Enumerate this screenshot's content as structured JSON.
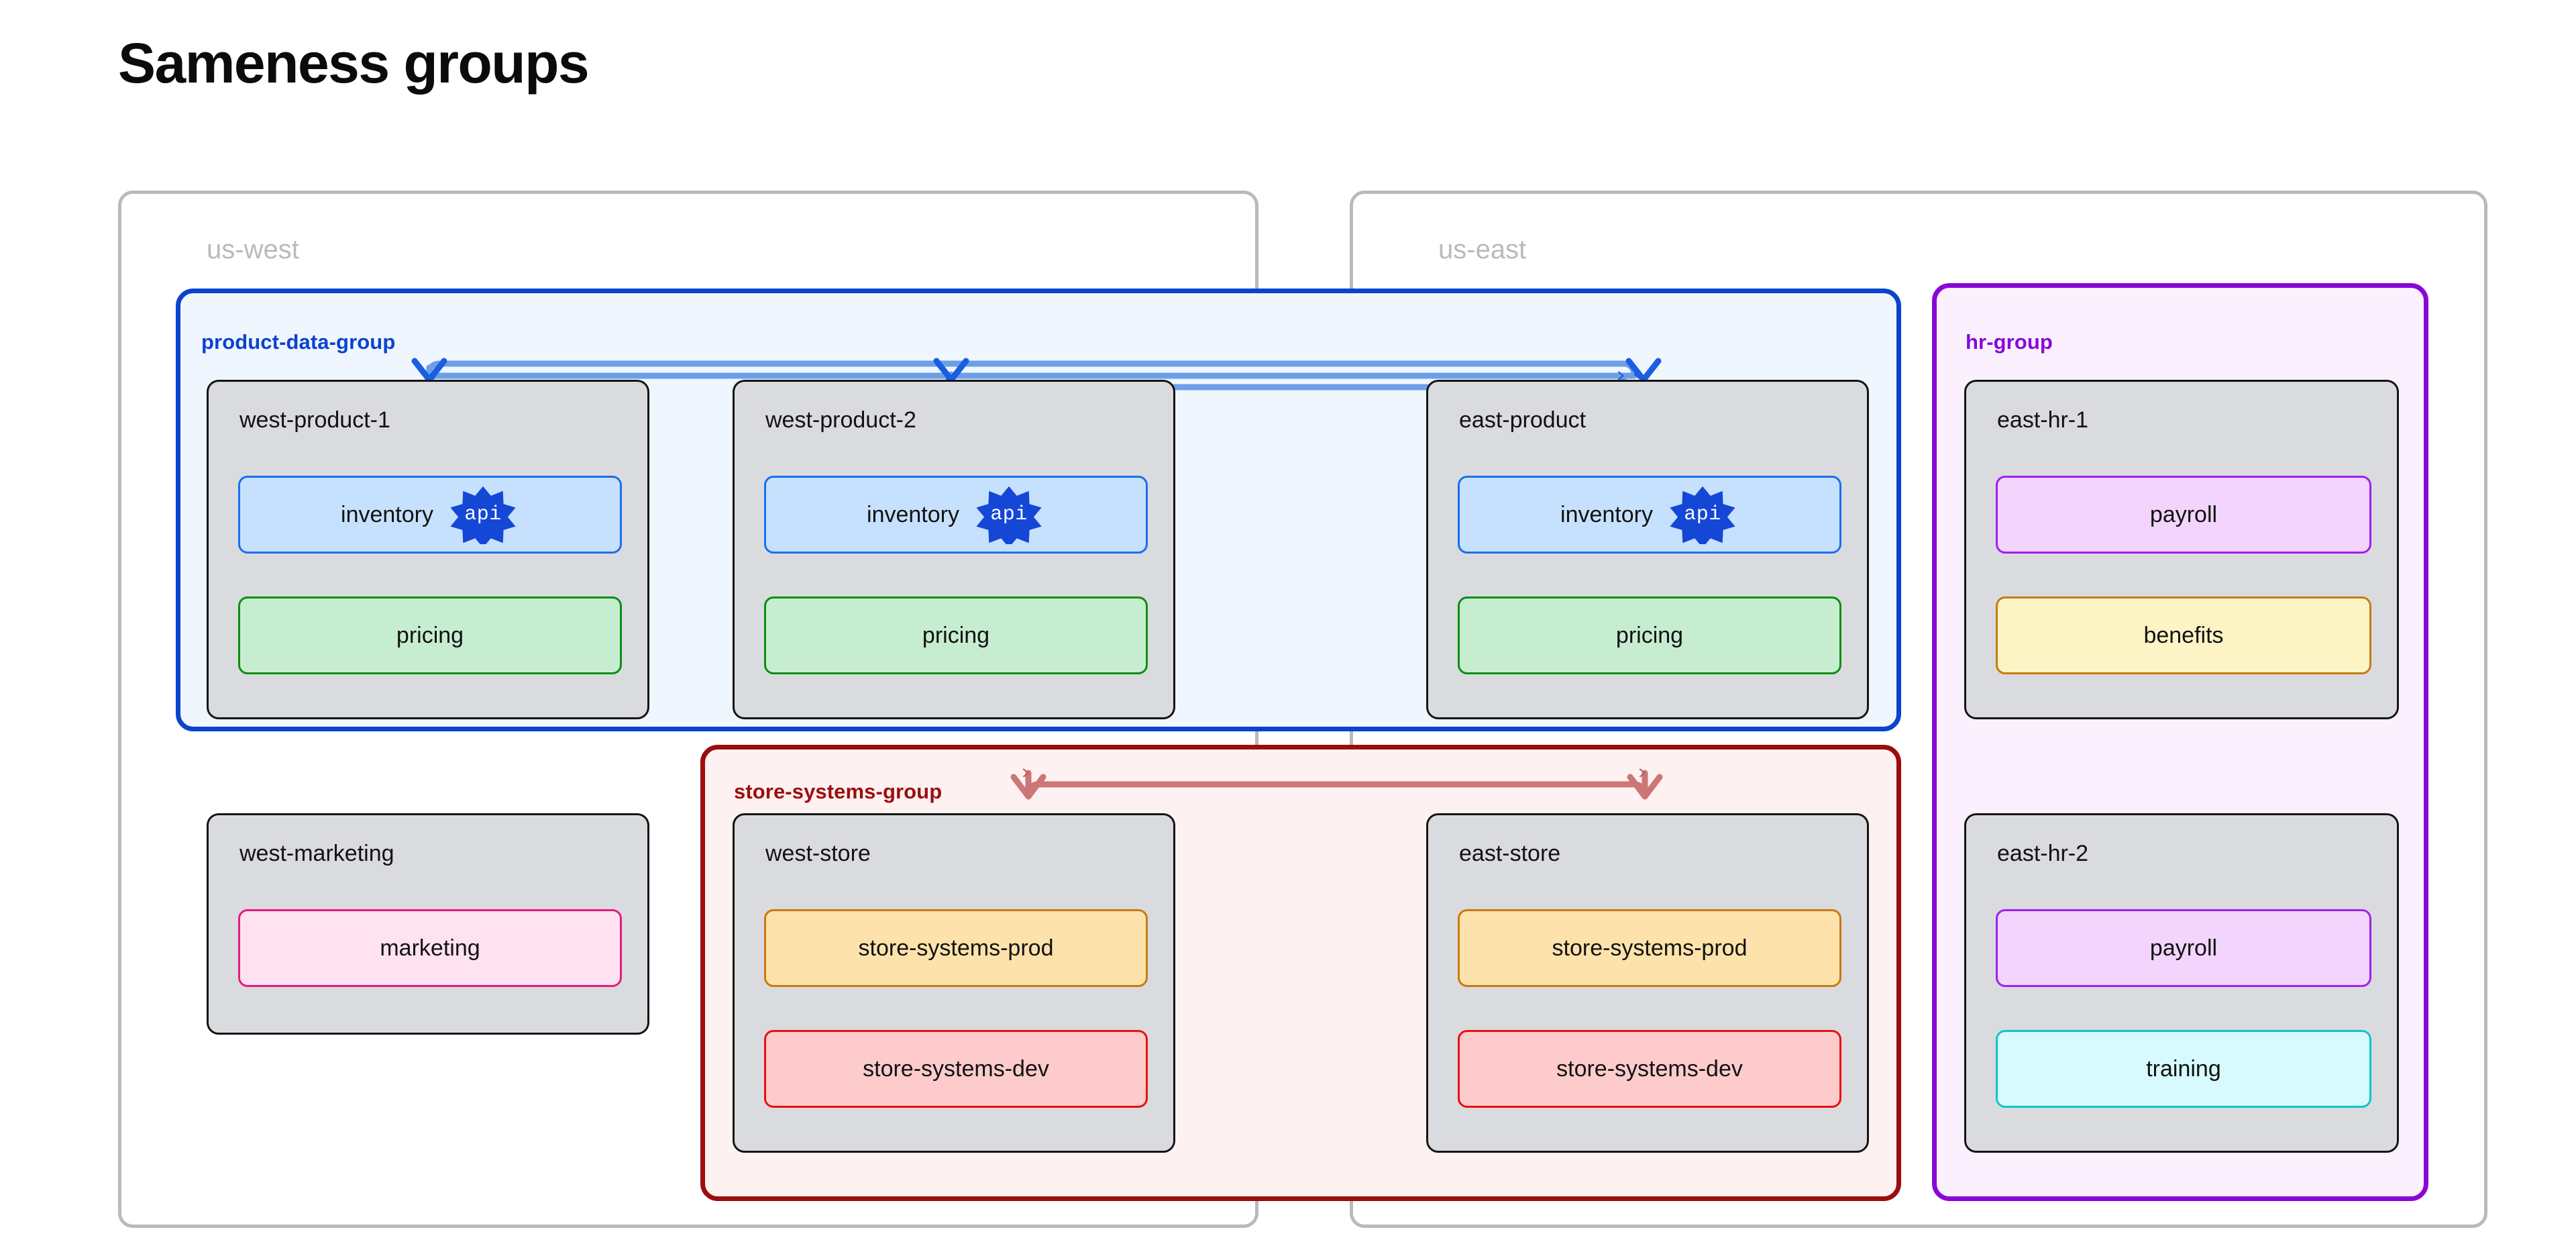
{
  "page": {
    "title": "Sameness groups"
  },
  "regions": [
    {
      "id": "us-west",
      "label": "us-west"
    },
    {
      "id": "us-east",
      "label": "us-east"
    }
  ],
  "groups": [
    {
      "id": "product-data-group",
      "label": "product-data-group",
      "border_color": "#0b43cf",
      "fill_color": "#f0f6fe"
    },
    {
      "id": "store-systems-group",
      "label": "store-systems-group",
      "border_color": "#9c0d0d",
      "fill_color": "#fdf2f1"
    },
    {
      "id": "hr-group",
      "label": "hr-group",
      "border_color": "#8a06d6",
      "fill_color": "#fbf1fe"
    }
  ],
  "nodes": [
    {
      "id": "west-product-1",
      "title": "west-product-1",
      "region": "us-west",
      "group": "product-data-group",
      "services": [
        {
          "id": "inventory",
          "label": "inventory",
          "badge": "api",
          "fill": "#c6e1fd",
          "border": "#1a6ef0"
        },
        {
          "id": "pricing",
          "label": "pricing",
          "badge": null,
          "fill": "#c7edd1",
          "border": "#0a8f12"
        }
      ]
    },
    {
      "id": "west-product-2",
      "title": "west-product-2",
      "region": "us-west",
      "group": "product-data-group",
      "services": [
        {
          "id": "inventory",
          "label": "inventory",
          "badge": "api",
          "fill": "#c6e1fd",
          "border": "#1a6ef0"
        },
        {
          "id": "pricing",
          "label": "pricing",
          "badge": null,
          "fill": "#c7edd1",
          "border": "#0a8f12"
        }
      ]
    },
    {
      "id": "east-product",
      "title": "east-product",
      "region": "us-east",
      "group": "product-data-group",
      "services": [
        {
          "id": "inventory",
          "label": "inventory",
          "badge": "api",
          "fill": "#c6e1fd",
          "border": "#1a6ef0"
        },
        {
          "id": "pricing",
          "label": "pricing",
          "badge": null,
          "fill": "#c7edd1",
          "border": "#0a8f12"
        }
      ]
    },
    {
      "id": "east-hr-1",
      "title": "east-hr-1",
      "region": "us-east",
      "group": "hr-group",
      "services": [
        {
          "id": "payroll",
          "label": "payroll",
          "badge": null,
          "fill": "#f2d4fd",
          "border": "#a11ff0"
        },
        {
          "id": "benefits",
          "label": "benefits",
          "badge": null,
          "fill": "#fdf4c5",
          "border": "#c87a10"
        }
      ]
    },
    {
      "id": "west-marketing",
      "title": "west-marketing",
      "region": "us-west",
      "group": null,
      "services": [
        {
          "id": "marketing",
          "label": "marketing",
          "badge": null,
          "fill": "#ffe2ef",
          "border": "#e51b7e"
        }
      ]
    },
    {
      "id": "west-store",
      "title": "west-store",
      "region": "us-west",
      "group": "store-systems-group",
      "services": [
        {
          "id": "store-systems-prod",
          "label": "store-systems-prod",
          "badge": null,
          "fill": "#fde3ab",
          "border": "#c87a10"
        },
        {
          "id": "store-systems-dev",
          "label": "store-systems-dev",
          "badge": null,
          "fill": "#fdcbcb",
          "border": "#e81010"
        }
      ]
    },
    {
      "id": "east-store",
      "title": "east-store",
      "region": "us-east",
      "group": "store-systems-group",
      "services": [
        {
          "id": "store-systems-prod",
          "label": "store-systems-prod",
          "badge": null,
          "fill": "#fde3ab",
          "border": "#c87a10"
        },
        {
          "id": "store-systems-dev",
          "label": "store-systems-dev",
          "badge": null,
          "fill": "#fdcbcb",
          "border": "#e81010"
        }
      ]
    },
    {
      "id": "east-hr-2",
      "title": "east-hr-2",
      "region": "us-east",
      "group": "hr-group",
      "services": [
        {
          "id": "payroll",
          "label": "payroll",
          "badge": null,
          "fill": "#f2d4fd",
          "border": "#a11ff0"
        },
        {
          "id": "training",
          "label": "training",
          "badge": null,
          "fill": "#d6fafd",
          "border": "#10c3cf"
        }
      ]
    }
  ],
  "edges": [
    {
      "id": "edge-west-product-1-east-product",
      "from": "west-product-1",
      "to": "east-product",
      "group": "product-data-group",
      "color": "#6d9fe8",
      "arrowheads": "both"
    },
    {
      "id": "edge-west-product-2-east-product",
      "from": "west-product-2",
      "to": "east-product",
      "group": "product-data-group",
      "color": "#6d9fe8",
      "arrowheads": "both"
    },
    {
      "id": "edge-west-store-east-store",
      "from": "west-store",
      "to": "east-store",
      "group": "store-systems-group",
      "color": "#cc7676",
      "arrowheads": "both"
    }
  ],
  "badges": {
    "api": {
      "text": "api",
      "shape": "starburst",
      "fill": "#1447d6",
      "text_color": "#ffffff"
    }
  },
  "colors": {
    "region_border": "#b7babf",
    "region_label": "#b7babf",
    "node_fill": "#dadbde",
    "node_border": "#141414",
    "page_background": "#ffffff",
    "title_color": "#0b0b0b"
  }
}
